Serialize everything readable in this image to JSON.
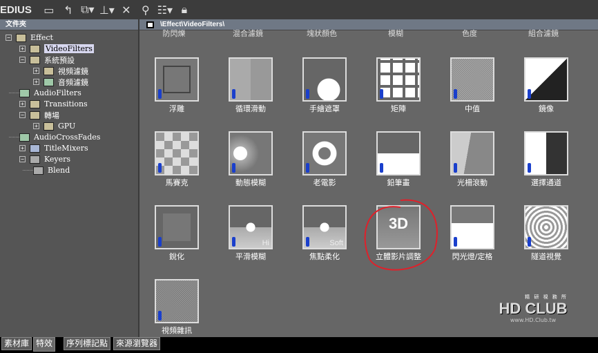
{
  "app": {
    "title": "EDIUS"
  },
  "toolbar": {
    "icons": [
      "new-folder-icon",
      "up-folder-icon",
      "copy-dropdown-icon",
      "layout-dropdown-icon",
      "delete-icon",
      "properties-icon",
      "view-dropdown-icon",
      "lock-icon"
    ]
  },
  "left": {
    "header": "文件夾",
    "tree": [
      {
        "label": "Effect",
        "expander": "−"
      },
      {
        "label": "VideoFilters",
        "expander": "+"
      },
      {
        "label": "系統預設",
        "expander": "−"
      },
      {
        "label": "視頻濾鏡",
        "expander": "+"
      },
      {
        "label": "音頻濾鏡",
        "expander": "+"
      },
      {
        "label": "AudioFilters",
        "expander": ""
      },
      {
        "label": "Transitions",
        "expander": "+"
      },
      {
        "label": "轉場",
        "expander": "−"
      },
      {
        "label": "GPU",
        "expander": "+"
      },
      {
        "label": "AudioCrossFades",
        "expander": ""
      },
      {
        "label": "TitleMixers",
        "expander": "+"
      },
      {
        "label": "Keyers",
        "expander": "−"
      },
      {
        "label": "Blend",
        "expander": ""
      }
    ]
  },
  "right": {
    "path": "\\Effect\\VideoFilters\\",
    "top_row": [
      "防閃爍",
      "混合濾鏡",
      "塊狀顏色",
      "模糊",
      "色度",
      "組合濾鏡"
    ],
    "items": [
      {
        "label": "浮雕"
      },
      {
        "label": "循環滑動"
      },
      {
        "label": "手繪遮罩"
      },
      {
        "label": "矩陣"
      },
      {
        "label": "中值"
      },
      {
        "label": "鏡像"
      },
      {
        "label": "馬賽克"
      },
      {
        "label": "動態模糊"
      },
      {
        "label": "老電影"
      },
      {
        "label": "鉛筆畫"
      },
      {
        "label": "光柵滾動"
      },
      {
        "label": "選擇通道"
      },
      {
        "label": "銳化"
      },
      {
        "label": "平滑模糊",
        "tag": "Hi"
      },
      {
        "label": "焦點柔化",
        "tag": "Soft"
      },
      {
        "label": "立體影片調整",
        "tag": "3D"
      },
      {
        "label": "閃光燈/定格"
      },
      {
        "label": "隧道視覺"
      },
      {
        "label": "視頻雜訊"
      }
    ]
  },
  "bottom_tabs": [
    "素材庫",
    "特效",
    "序列標記點",
    "來源瀏覽器"
  ],
  "watermark": {
    "text": "HD CLUB",
    "small": "精 研 視 務 所",
    "url": "www.HD.Club.tw"
  },
  "colors": {
    "highlight": "#e0202a",
    "accent": "#1a3fcc"
  }
}
